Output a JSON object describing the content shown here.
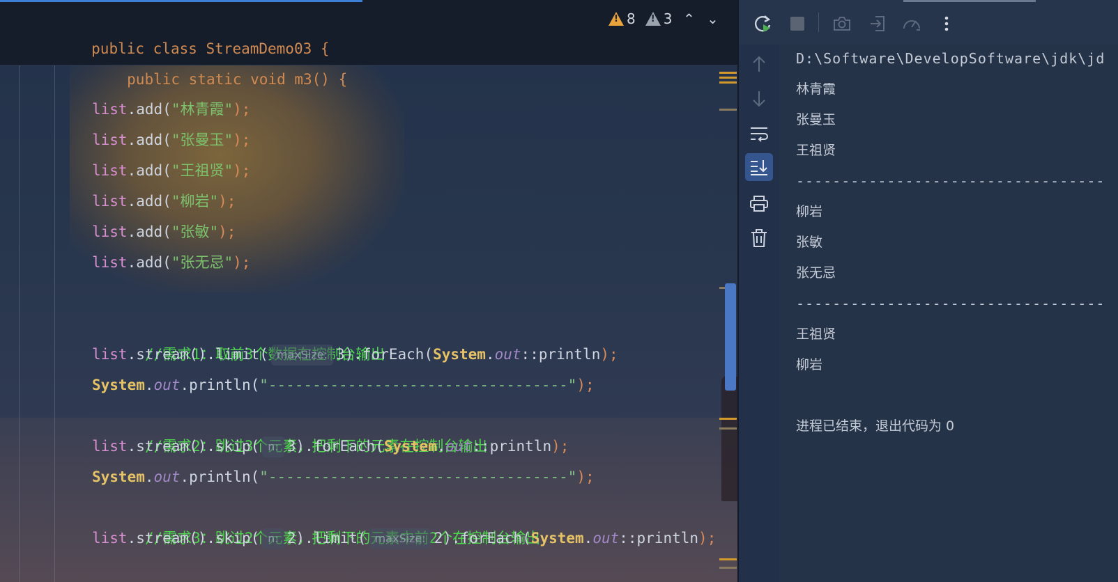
{
  "editor": {
    "sticky_class": "public class StreamDemo03 {",
    "sticky_method": "public static void m3() {",
    "warnings_count": "8",
    "weak_warnings_count": "3",
    "list_var": "list",
    "add_method": ".add",
    "adds": [
      {
        "name": "\"林青霞\""
      },
      {
        "name": "\"张曼玉\""
      },
      {
        "name": "\"王祖贤\""
      },
      {
        "name": "\"柳岩\""
      },
      {
        "name": "\"张敏\""
      },
      {
        "name": "\"张无忌\""
      }
    ],
    "comment1": "//需求1：取前3个数据在控制台输出",
    "comment2": "//需求2：跳过3个元素，把剩下的元素在控制台输出",
    "comment3": "//需求3：跳过2个元素，把剩下的元素中前2个在控制台输出",
    "stream": ".stream()",
    "limit": ".limit(",
    "skip": ".skip(",
    "foreach": ".forEach(",
    "system": "System",
    "dot": ".",
    "out": "out",
    "println_ref": "::println",
    "println": ".println(",
    "hint_maxsize": "maxSize:",
    "hint_n": "n:",
    "val3": "3",
    "val2": "2",
    "separator_str": "\"----------------------------------\"",
    "close_paren_semi": ");",
    "open_paren": "(",
    "close_paren": ")",
    "close_brace": "}"
  },
  "run": {
    "output": [
      "D:\\Software\\DevelopSoftware\\jdk\\jd",
      "林青霞",
      "张曼玉",
      "王祖贤",
      "----------------------------------",
      "柳岩",
      "张敏",
      "张无忌",
      "----------------------------------",
      "王祖贤",
      "柳岩",
      "",
      "进程已结束，退出代码为 0"
    ]
  },
  "colors": {
    "accent": "#3d7fd6",
    "warning": "#e8a33a",
    "comment": "#4fd44f",
    "string": "#7cc26c",
    "keyword": "#d08a52"
  }
}
